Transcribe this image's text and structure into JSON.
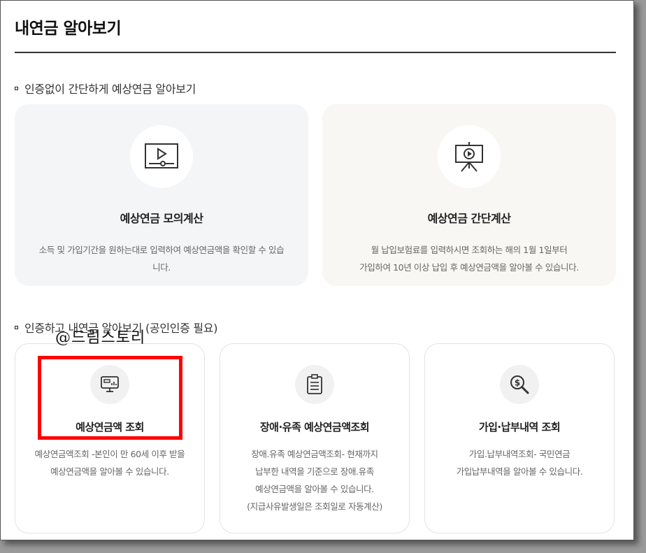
{
  "page": {
    "title": "내연금 알아보기"
  },
  "section1": {
    "heading": "인증없이 간단하게 예상연금 알아보기",
    "cards": [
      {
        "icon": "video-play-icon",
        "title": "예상연금 모의계산",
        "desc": "소득 및 가입기간을 원하는대로 입력하여 예상연금액을 확인할 수 있습니다."
      },
      {
        "icon": "presentation-board-icon",
        "title": "예상연금 간단계산",
        "desc_line1": "월 납입보험료를 입력하시면 조회하는 해의 1월 1일부터",
        "desc_line2": "가입하여 10년 이상 납입 후 예상연금액을 알아볼 수 있습니다."
      }
    ]
  },
  "section2": {
    "heading": "인증하고 내연금 알아보기 (공인인증 필요)",
    "cards": [
      {
        "icon": "monitor-chart-icon",
        "title": "예상연금액 조회",
        "desc_line1": "예상연금액조회 -본인이 만 60세 이후 받을",
        "desc_line2": "예상연금액을 알아볼 수 있습니다."
      },
      {
        "icon": "clipboard-icon",
        "title": "장애·유족 예상연금액조회",
        "desc_line1": "장애.유족 예상연금액조회- 현재까지",
        "desc_line2": "납부한 내역을 기준으로 장애.유족",
        "desc_line3": "예상연금액을 알아볼 수 있습니다.",
        "desc_line4": "(지급사유발생일은 조회일로 자동계산)"
      },
      {
        "icon": "magnifier-dollar-icon",
        "title": "가입·납부내역 조회",
        "desc_line1": "가입.납부내역조회- 국민연금",
        "desc_line2": "가입납부내역을 알아볼 수 있습니다."
      }
    ]
  },
  "overlay": {
    "watermark": "@드림스토리"
  },
  "colors": {
    "highlight": "#ff0000",
    "icon": "#333333"
  }
}
